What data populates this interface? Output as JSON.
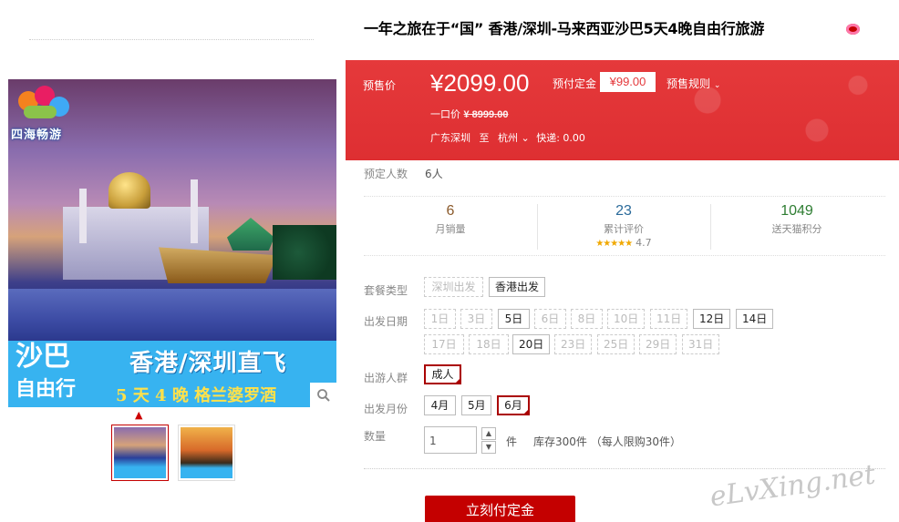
{
  "product": {
    "title": "一年之旅在于“国” 香港/深圳-马来西亚沙巴5天4晚自由行旅游",
    "title_icon": "flower-icon"
  },
  "gallery": {
    "logo_text": "四海畅游",
    "banner_big1": "沙巴",
    "banner_big2": "自由行",
    "banner_route": "香港/深圳直飞",
    "banner_sub": "5 天 4 晚  格兰婆罗酒",
    "zoom_icon": "search-icon",
    "thumbnails": [
      "thumb-1",
      "thumb-2"
    ]
  },
  "price": {
    "presale_label": "预售价",
    "presale_price": "¥2099.00",
    "deposit_label": "预付定金",
    "deposit_value": "¥99.00",
    "rules_label": "预售规则",
    "original_label": "一口价",
    "original_price": "¥ 8999.00",
    "from": "广东深圳",
    "to_word": "至",
    "destination": "杭州",
    "shipping": "快递: 0.00"
  },
  "booking": {
    "label": "预定人数",
    "value": "6人"
  },
  "stats": [
    {
      "value": "6",
      "label": "月销量",
      "color": "#8b5a2b"
    },
    {
      "value": "23",
      "label": "累计评价",
      "color": "#2a6a9a",
      "stars": "★★★★★",
      "rating": "4.7"
    },
    {
      "value": "1049",
      "label": "送天猫积分",
      "color": "#2e7d32"
    }
  ],
  "options": {
    "package_label": "套餐类型",
    "packages": [
      "深圳出发",
      "香港出发"
    ],
    "date_label": "出发日期",
    "dates_row1": [
      "1日",
      "3日",
      "5日",
      "6日",
      "8日",
      "10日",
      "11日",
      "12日",
      "14日"
    ],
    "dates_row2": [
      "17日",
      "18日",
      "20日",
      "23日",
      "25日",
      "29日",
      "31日"
    ],
    "people_label": "出游人群",
    "people": [
      "成人"
    ],
    "month_label": "出发月份",
    "months": [
      "4月",
      "5月",
      "6月"
    ],
    "qty_label": "数量",
    "qty_value": "1",
    "unit": "件",
    "stock": "库存300件 （每人限购30件）"
  },
  "actions": {
    "buy_label": "立刻付定金"
  },
  "watermark": "eLvXing.net"
}
